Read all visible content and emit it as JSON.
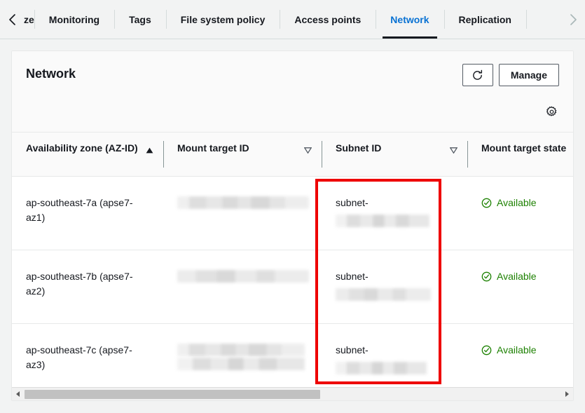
{
  "tabs": {
    "prev_icon": "chevron-left-icon",
    "next_icon": "chevron-right-icon",
    "items": [
      {
        "label": "ze",
        "active": false,
        "clipped": true
      },
      {
        "label": "Monitoring",
        "active": false
      },
      {
        "label": "Tags",
        "active": false
      },
      {
        "label": "File system policy",
        "active": false
      },
      {
        "label": "Access points",
        "active": false
      },
      {
        "label": "Network",
        "active": true
      },
      {
        "label": "Replication",
        "active": false
      }
    ]
  },
  "panel": {
    "title": "Network",
    "refresh_icon": "refresh-icon",
    "manage_label": "Manage",
    "preferences_icon": "gear-icon"
  },
  "table": {
    "columns": [
      {
        "label": "Availability zone (AZ-ID)",
        "sort": "asc"
      },
      {
        "label": "Mount target ID",
        "sort": "none"
      },
      {
        "label": "Subnet ID",
        "sort": "none"
      },
      {
        "label": "Mount target state",
        "sort": null
      }
    ],
    "rows": [
      {
        "az": "ap-southeast-7a (apse7-az1)",
        "mount_target_id": "",
        "subnet_prefix": "subnet-",
        "state": "Available",
        "state_icon": "check-circle-icon"
      },
      {
        "az": "ap-southeast-7b (apse7-az2)",
        "mount_target_id": "",
        "subnet_prefix": "subnet-",
        "state": "Available",
        "state_icon": "check-circle-icon"
      },
      {
        "az": "ap-southeast-7c (apse7-az3)",
        "mount_target_id": "",
        "subnet_prefix": "subnet-",
        "state": "Available",
        "state_icon": "check-circle-icon"
      }
    ]
  },
  "annotation": {
    "color": "#ee0000",
    "target_column": "Subnet ID"
  },
  "scrollbar": {
    "left_icon": "scroll-left-arrow-icon",
    "right_icon": "scroll-right-arrow-icon",
    "thumb_percent": 55
  },
  "colors": {
    "accent": "#0972d3",
    "active_tab_underline": "#16191f",
    "status_green": "#1d8102",
    "annotation_red": "#ee0000"
  }
}
